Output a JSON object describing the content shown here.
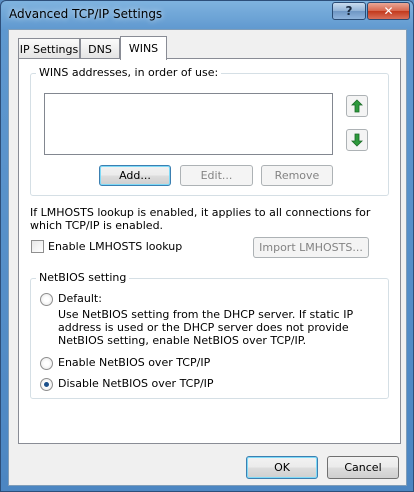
{
  "window": {
    "title": "Advanced TCP/IP Settings",
    "help_glyph": "?",
    "close_glyph": "✕"
  },
  "tabs": [
    {
      "label": "IP Settings"
    },
    {
      "label": "DNS"
    },
    {
      "label": "WINS"
    }
  ],
  "wins": {
    "group_label": "WINS addresses, in order of use:",
    "addresses": [],
    "add_label": "Add...",
    "edit_label": "Edit...",
    "remove_label": "Remove"
  },
  "lmhosts": {
    "info_text": "If LMHOSTS lookup is enabled, it applies to all connections for which TCP/IP is enabled.",
    "checkbox_label": "Enable LMHOSTS lookup",
    "checked": false,
    "import_label": "Import LMHOSTS..."
  },
  "netbios": {
    "group_label": "NetBIOS setting",
    "options": [
      {
        "label": "Default:",
        "checked": false
      },
      {
        "label": "Enable NetBIOS over TCP/IP",
        "checked": false
      },
      {
        "label": "Disable NetBIOS over TCP/IP",
        "checked": true
      }
    ],
    "default_description": "Use NetBIOS setting from the DHCP server. If static IP address is used or the DHCP server does not provide NetBIOS setting, enable NetBIOS over TCP/IP."
  },
  "footer": {
    "ok_label": "OK",
    "cancel_label": "Cancel"
  },
  "colors": {
    "arrow_green": "#2e9a3c",
    "radio_dot": "#1a4f8a"
  },
  "icons": {
    "move_up": "arrow-up-icon",
    "move_down": "arrow-down-icon"
  }
}
